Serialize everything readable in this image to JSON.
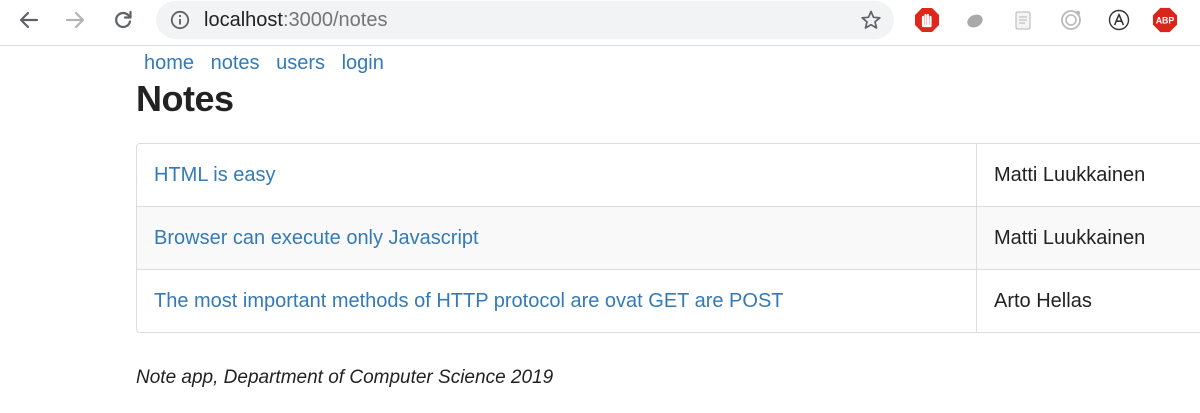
{
  "browser": {
    "url_host": "localhost",
    "url_path": ":3000/notes"
  },
  "menu": {
    "items": [
      "home",
      "notes",
      "users",
      "login"
    ]
  },
  "page": {
    "title": "Notes"
  },
  "notes": [
    {
      "content": "HTML is easy",
      "user": "Matti Luukkainen"
    },
    {
      "content": "Browser can execute only Javascript",
      "user": "Matti Luukkainen"
    },
    {
      "content": "The most important methods of HTTP protocol are ovat GET are POST",
      "user": "Arto Hellas"
    }
  ],
  "footer": {
    "text": "Note app, Department of Computer Science 2019"
  },
  "extensions": {
    "adblock_label": "ABP"
  },
  "colors": {
    "link": "#337ab7",
    "table_border": "#dddddd",
    "stripe": "#f9f9f9"
  }
}
